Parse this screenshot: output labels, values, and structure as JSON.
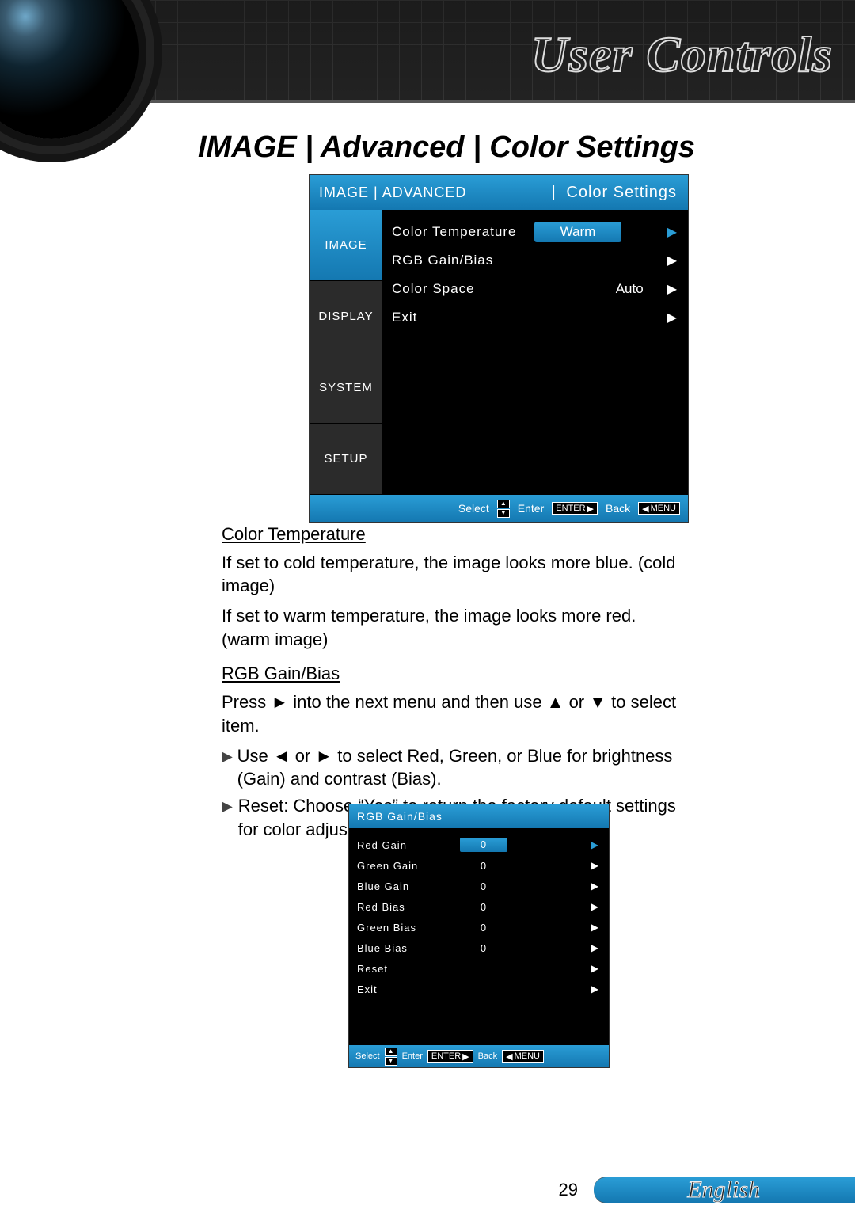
{
  "header": {
    "title": "User Controls"
  },
  "breadcrumb": "IMAGE | Advanced | Color Settings",
  "osd_main": {
    "header_left": "IMAGE | ADVANCED",
    "header_right": "Color Settings",
    "tabs": [
      "IMAGE",
      "DISPLAY",
      "SYSTEM",
      "SETUP"
    ],
    "active_tab": 0,
    "rows": [
      {
        "label": "Color Temperature",
        "value": "Warm",
        "highlighted": true
      },
      {
        "label": "RGB Gain/Bias",
        "value": "",
        "highlighted": false
      },
      {
        "label": "Color Space",
        "value": "Auto",
        "highlighted": false
      },
      {
        "label": "Exit",
        "value": "",
        "highlighted": false
      }
    ],
    "footer": {
      "select": "Select",
      "enter": "Enter",
      "enter_key": "ENTER",
      "back": "Back",
      "menu_key": "MENU"
    }
  },
  "sections": {
    "color_temp": {
      "heading": "Color Temperature",
      "p1": "If set to cold temperature, the image looks more blue. (cold image)",
      "p2": "If set to warm temperature, the image looks more red. (warm image)"
    },
    "rgb": {
      "heading": "RGB Gain/Bias",
      "p1": "Press ► into the next menu and then use ▲ or ▼ to select item.",
      "b1": "Use ◄ or ► to select Red, Green, or Blue for brightness (Gain) and contrast (Bias).",
      "b2": "Reset: Choose “Yes” to return the factory default settings for color adjustments."
    }
  },
  "osd_sub": {
    "header": "RGB Gain/Bias",
    "rows": [
      {
        "label": "Red Gain",
        "value": "0",
        "active": true
      },
      {
        "label": "Green Gain",
        "value": "0",
        "active": false
      },
      {
        "label": "Blue Gain",
        "value": "0",
        "active": false
      },
      {
        "label": "Red Bias",
        "value": "0",
        "active": false
      },
      {
        "label": "Green Bias",
        "value": "0",
        "active": false
      },
      {
        "label": "Blue Bias",
        "value": "0",
        "active": false
      },
      {
        "label": "Reset",
        "value": "",
        "active": false
      },
      {
        "label": "Exit",
        "value": "",
        "active": false
      }
    ],
    "footer": {
      "select": "Select",
      "enter": "Enter",
      "enter_key": "ENTER",
      "back": "Back",
      "menu_key": "MENU"
    }
  },
  "page": {
    "number": "29",
    "language": "English"
  }
}
